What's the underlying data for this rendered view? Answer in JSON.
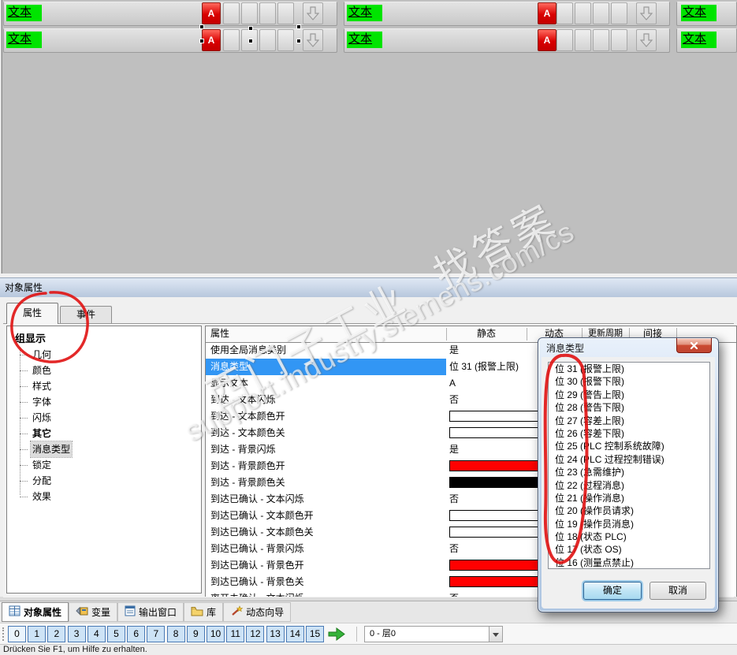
{
  "canvas": {
    "text_label": "文本",
    "ack_label": "A",
    "arrow_icon": "down-arrow-icon"
  },
  "watermarks": {
    "line_cn": "西门子工业 找答案",
    "line_en": "support.industry.siemens.com/cs"
  },
  "colors": {
    "alarm_green": "#00e400",
    "alarm_red": "#d90000",
    "selection_blue": "#3296f4",
    "canvas_gray": "#bfbfbf"
  },
  "panel": {
    "title": "对象属性",
    "tabs": [
      {
        "label": "属性",
        "active": true
      },
      {
        "label": "事件",
        "active": false
      }
    ],
    "tree": {
      "root": "组显示",
      "items": [
        {
          "label": "几何"
        },
        {
          "label": "颜色"
        },
        {
          "label": "样式"
        },
        {
          "label": "字体"
        },
        {
          "label": "闪烁"
        },
        {
          "label": "其它",
          "bold": true
        },
        {
          "label": "消息类型",
          "selected": true
        },
        {
          "label": "锁定"
        },
        {
          "label": "分配"
        },
        {
          "label": "效果"
        }
      ]
    },
    "table": {
      "headers": [
        "属性",
        "静态",
        "动态",
        "更新周期",
        "间接"
      ],
      "rows": [
        {
          "name": "使用全局消息类别",
          "value": "是",
          "type": "text"
        },
        {
          "name": "消息类型",
          "value": "位 31 (报警上限)",
          "type": "text",
          "selected": true
        },
        {
          "name": "显示文本",
          "value": "A",
          "type": "text"
        },
        {
          "name": "到达 - 文本闪烁",
          "value": "否",
          "type": "text"
        },
        {
          "name": "到达 - 文本颜色开",
          "value": "#ffffff",
          "type": "color"
        },
        {
          "name": "到达 - 文本颜色关",
          "value": "#ffffff",
          "type": "color"
        },
        {
          "name": "到达 - 背景闪烁",
          "value": "是",
          "type": "text"
        },
        {
          "name": "到达 - 背景颜色开",
          "value": "#ff0000",
          "type": "color"
        },
        {
          "name": "到达 - 背景颜色关",
          "value": "#000000",
          "type": "color"
        },
        {
          "name": "到达已确认 - 文本闪烁",
          "value": "否",
          "type": "text"
        },
        {
          "name": "到达已确认 - 文本颜色开",
          "value": "#ffffff",
          "type": "color"
        },
        {
          "name": "到达已确认 - 文本颜色关",
          "value": "#ffffff",
          "type": "color"
        },
        {
          "name": "到达已确认 - 背景闪烁",
          "value": "否",
          "type": "text"
        },
        {
          "name": "到达已确认 - 背景色开",
          "value": "#ff0000",
          "type": "color"
        },
        {
          "name": "到达已确认 - 背景色关",
          "value": "#ff0000",
          "type": "color"
        },
        {
          "name": "离开未确认 - 文本闪烁",
          "value": "否",
          "type": "text"
        }
      ]
    }
  },
  "dialog": {
    "title": "消息类型",
    "items": [
      "位 31 (报警上限)",
      "位 30 (报警下限)",
      "位 29 (警告上限)",
      "位 28 (警告下限)",
      "位 27 (容差上限)",
      "位 26 (容差下限)",
      "位 25 (PLC 控制系统故障)",
      "位 24 (PLC 过程控制错误)",
      "位 23 (急需维护)",
      "位 22 (过程消息)",
      "位 21 (操作消息)",
      "位 20 (操作员请求)",
      "位 19 (操作员消息)",
      "位 18 (状态 PLC)",
      "位 17 (状态 OS)",
      "位 16 (测量点禁止)"
    ],
    "ok_label": "确定",
    "cancel_label": "取消"
  },
  "bottom_tabs": [
    {
      "label": "对象属性",
      "icon": "properties-icon",
      "active": true
    },
    {
      "label": "变量",
      "icon": "tags-icon",
      "active": false
    },
    {
      "label": "输出窗口",
      "icon": "output-window-icon",
      "active": false
    },
    {
      "label": "库",
      "icon": "library-icon",
      "active": false
    },
    {
      "label": "动态向导",
      "icon": "wizard-icon",
      "active": false
    }
  ],
  "layer_bar": {
    "layers": [
      "0",
      "1",
      "2",
      "3",
      "4",
      "5",
      "6",
      "7",
      "8",
      "9",
      "10",
      "11",
      "12",
      "13",
      "14",
      "15"
    ],
    "active_layer": "0",
    "selected_layer": "0 - 层0"
  },
  "status_bar": {
    "text": "Drücken Sie F1, um Hilfe zu erhalten."
  }
}
